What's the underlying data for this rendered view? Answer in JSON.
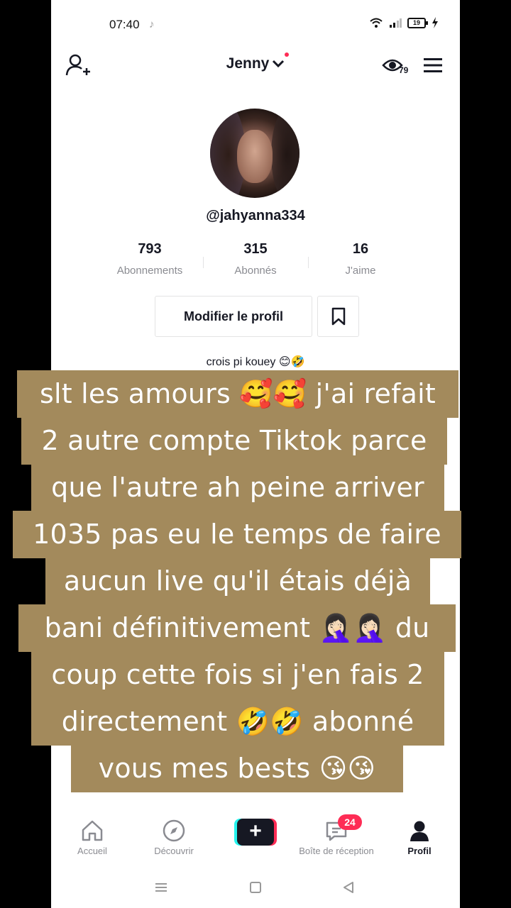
{
  "status_bar": {
    "time": "07:40",
    "battery": "19"
  },
  "header": {
    "account_name": "Jenny",
    "views_count": "79"
  },
  "profile": {
    "handle": "@jahyanna334",
    "stats": [
      {
        "value": "793",
        "label": "Abonnements"
      },
      {
        "value": "315",
        "label": "Abonnés"
      },
      {
        "value": "16",
        "label": "J'aime"
      }
    ],
    "edit_label": "Modifier le profil",
    "bio": "crois pi kouey 😊🤣"
  },
  "caption_lines": [
    "slt les amours 🥰🥰 j'ai refait",
    "2 autre compte Tiktok parce",
    "que l'autre ah peine arriver",
    "1035 pas eu le temps de faire",
    "aucun live qu'il étais déjà",
    "bani définitivement 🤦🏻‍♀️🤦🏻‍♀️ du",
    "coup cette fois si j'en fais 2",
    "directement 🤣🤣 abonné",
    "vous mes bests 😘😘"
  ],
  "bottom_nav": {
    "home": "Accueil",
    "discover": "Découvrir",
    "create": "+",
    "inbox": "Boîte de réception",
    "inbox_badge": "24",
    "profile": "Profil"
  },
  "colors": {
    "accent": "#fe2c55",
    "caption_bg": "#a38a5c",
    "text": "#161823",
    "secondary": "#8a8b91"
  }
}
